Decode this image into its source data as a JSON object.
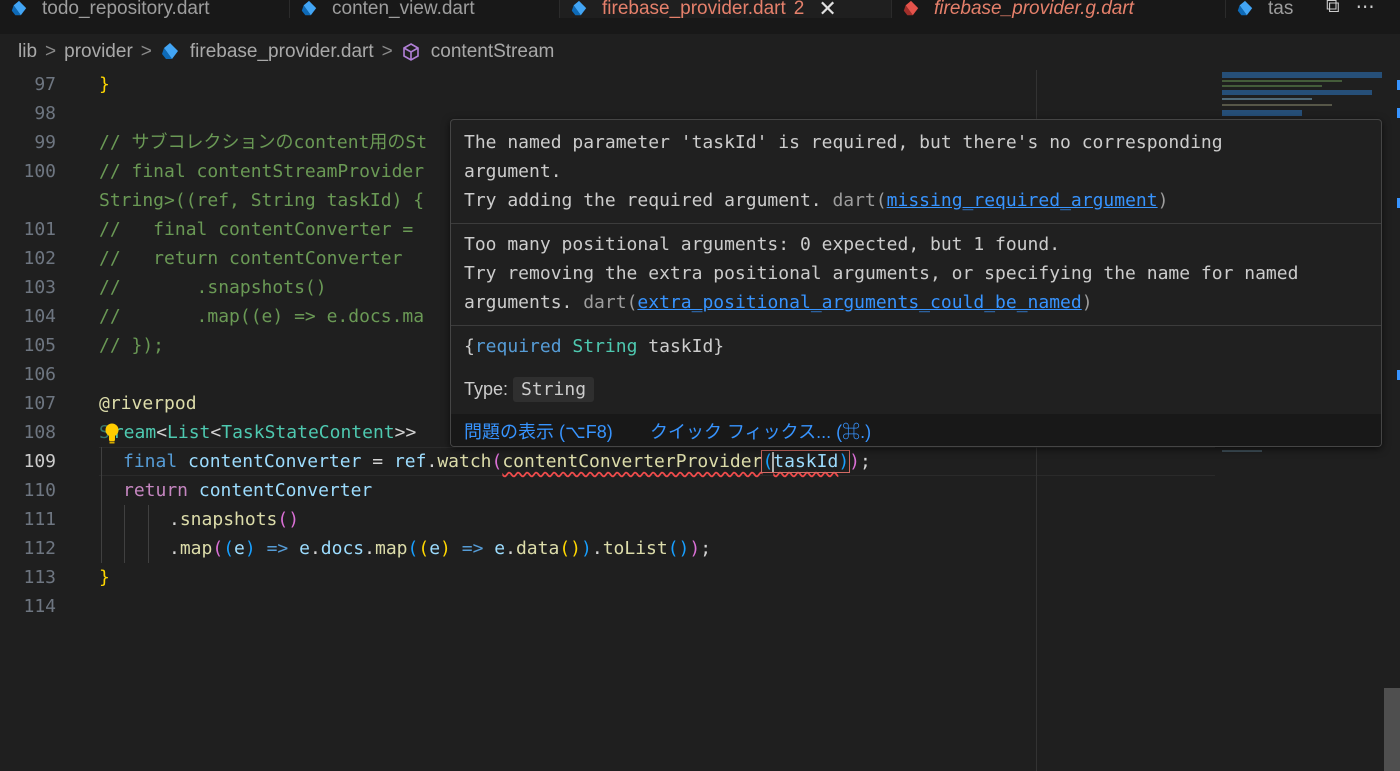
{
  "tabs": [
    {
      "label": "todo_repository.dart",
      "icon": "dart-icon",
      "active": false
    },
    {
      "label": "conten_view.dart",
      "icon": "dart-icon",
      "active": false
    },
    {
      "label": "firebase_provider.dart",
      "icon": "dart-icon",
      "active": true,
      "badge": "2",
      "close": "✕"
    },
    {
      "label": "firebase_provider.g.dart",
      "icon": "dart-icon",
      "active": false
    },
    {
      "label": "tas",
      "icon": "dart-icon",
      "active": false
    }
  ],
  "tab_actions": {
    "split": "⧉",
    "more": "⋯"
  },
  "breadcrumb": {
    "items": [
      "lib",
      "provider",
      "firebase_provider.dart",
      "contentStream"
    ],
    "sep": ">"
  },
  "editor": {
    "line_numbers": [
      "97",
      "98",
      "99",
      "100",
      "",
      "101",
      "102",
      "103",
      "104",
      "105",
      "106",
      "107",
      "108",
      "109",
      "110",
      "111",
      "112",
      "113",
      "114"
    ],
    "lines": {
      "l97": "}",
      "l99": "// サブコレクションのcontent用のSt",
      "l100a": "// final contentStreamProvider",
      "l100b": "String>((ref, String taskId) {",
      "l101": "//   final contentConverter = ",
      "l102": "//   return contentConverter",
      "l103": "//       .snapshots()",
      "l104": "//       .map((e) => e.docs.ma",
      "l105": "// });",
      "l107": "@riverpod",
      "l108_s": "S",
      "l108_rest": "ream",
      "l108_lt": "<",
      "l108_list": "List",
      "l108_lt2": "<",
      "l108_type": "TaskStateContent",
      "l108_gt": ">>",
      "l109_final": "final",
      "l109_var": "contentConverter",
      "l109_eq": "=",
      "l109_ref": "ref",
      "l109_watch": "watch",
      "l109_provider": "contentConverterProvider",
      "l109_arg": "taskId",
      "l109_end": ";",
      "l110_return": "return",
      "l110_var": "contentConverter",
      "l111_fn": "snapshots",
      "l112_map": "map",
      "l112_e": "e",
      "l112_arrow": "=>",
      "l112_docs": "docs",
      "l112_map2": "map",
      "l112_data": "data",
      "l112_tolist": "toList",
      "l113": "}"
    }
  },
  "hover": {
    "error1": {
      "line1": "The named parameter 'taskId' is required, but there's no corresponding",
      "line2": "argument.",
      "line3": "Try adding the required argument.",
      "source": "dart",
      "code": "missing_required_argument"
    },
    "error2": {
      "line1": "Too many positional arguments: 0 expected, but 1 found.",
      "line2": "Try removing the extra positional arguments, or specifying the name for named",
      "line3": "arguments.",
      "source": "dart",
      "code": "extra_positional_arguments_could_be_named"
    },
    "signature": {
      "open": "{",
      "required": "required",
      "type": "String",
      "name": "taskId",
      "close": "}"
    },
    "type_label": "Type:",
    "type_value": "String",
    "actions": {
      "view_problem": "問題の表示 (⌥F8)",
      "quick_fix": "クイック フィックス... (⌘.)"
    }
  },
  "colors": {
    "accent_error": "#f14c4c",
    "link": "#3794ff",
    "active_tab_text": "#e5806b"
  }
}
